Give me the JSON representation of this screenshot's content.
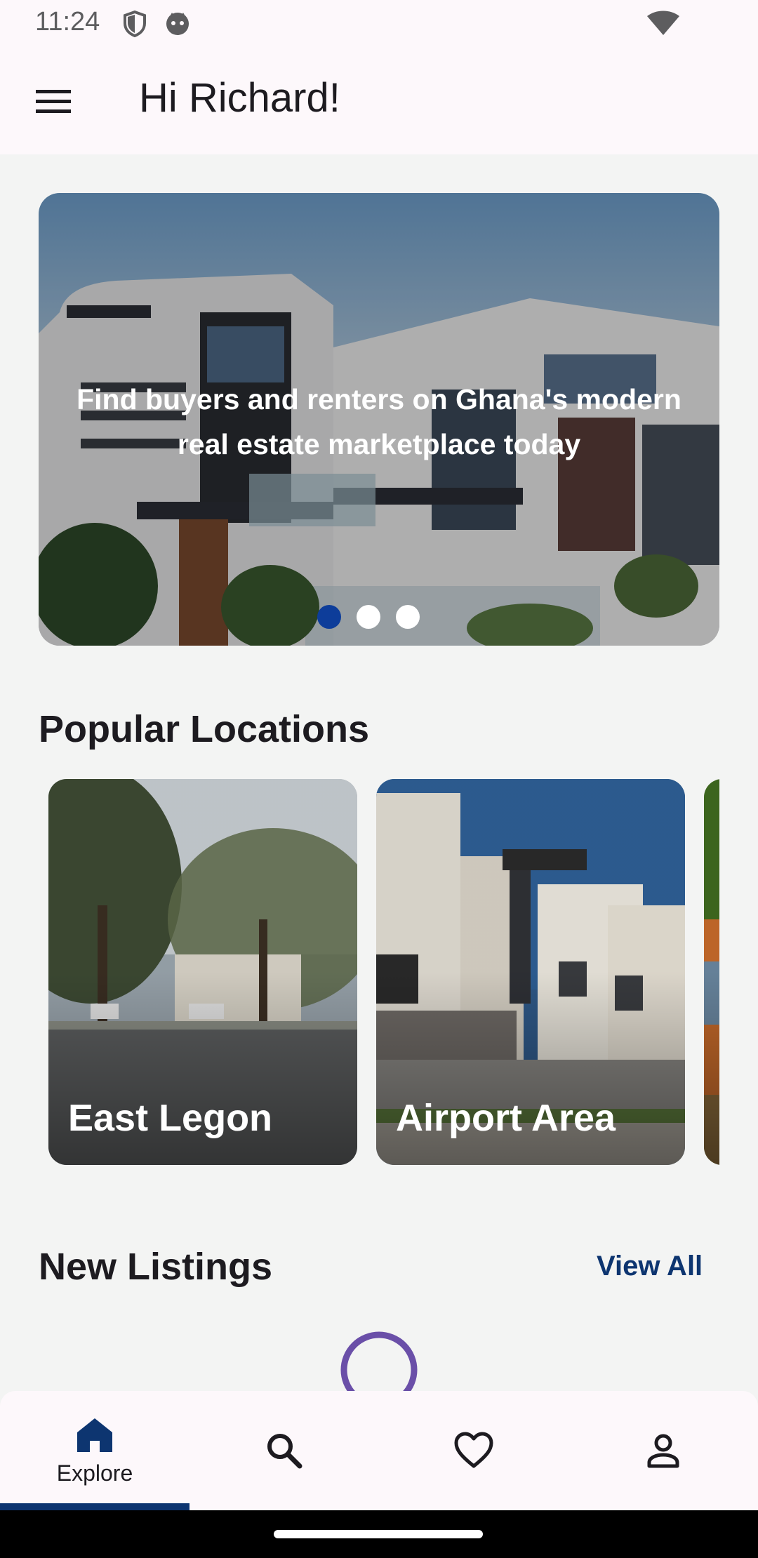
{
  "status_bar": {
    "time": "11:24",
    "icons": [
      "shield-icon",
      "face-icon",
      "wifi-icon"
    ]
  },
  "app_bar": {
    "greeting": "Hi Richard!",
    "menu_icon": "hamburger-menu-icon"
  },
  "hero": {
    "text": "Find buyers and renters on Ghana's modern real estate marketplace today",
    "carousel": {
      "total": 3,
      "active_index": 0
    },
    "active_dot_color": "#0d3d9a"
  },
  "popular_locations": {
    "title": "Popular Locations",
    "items": [
      {
        "label": "East Legon"
      },
      {
        "label": "Airport Area"
      },
      {
        "label": ""
      }
    ]
  },
  "new_listings": {
    "title": "New Listings",
    "view_all_label": "View All",
    "loading": true
  },
  "bottom_nav": {
    "items": [
      {
        "label": "Explore",
        "icon": "home-icon",
        "selected": true
      },
      {
        "label": "",
        "icon": "search-icon",
        "selected": false
      },
      {
        "label": "",
        "icon": "heart-icon",
        "selected": false
      },
      {
        "label": "",
        "icon": "person-icon",
        "selected": false
      }
    ],
    "accent_color": "#0d3570"
  },
  "colors": {
    "background": "#f3f4f3",
    "surface": "#fdf8fb",
    "accent": "#0d3570",
    "spinner": "#6a4fa8"
  }
}
